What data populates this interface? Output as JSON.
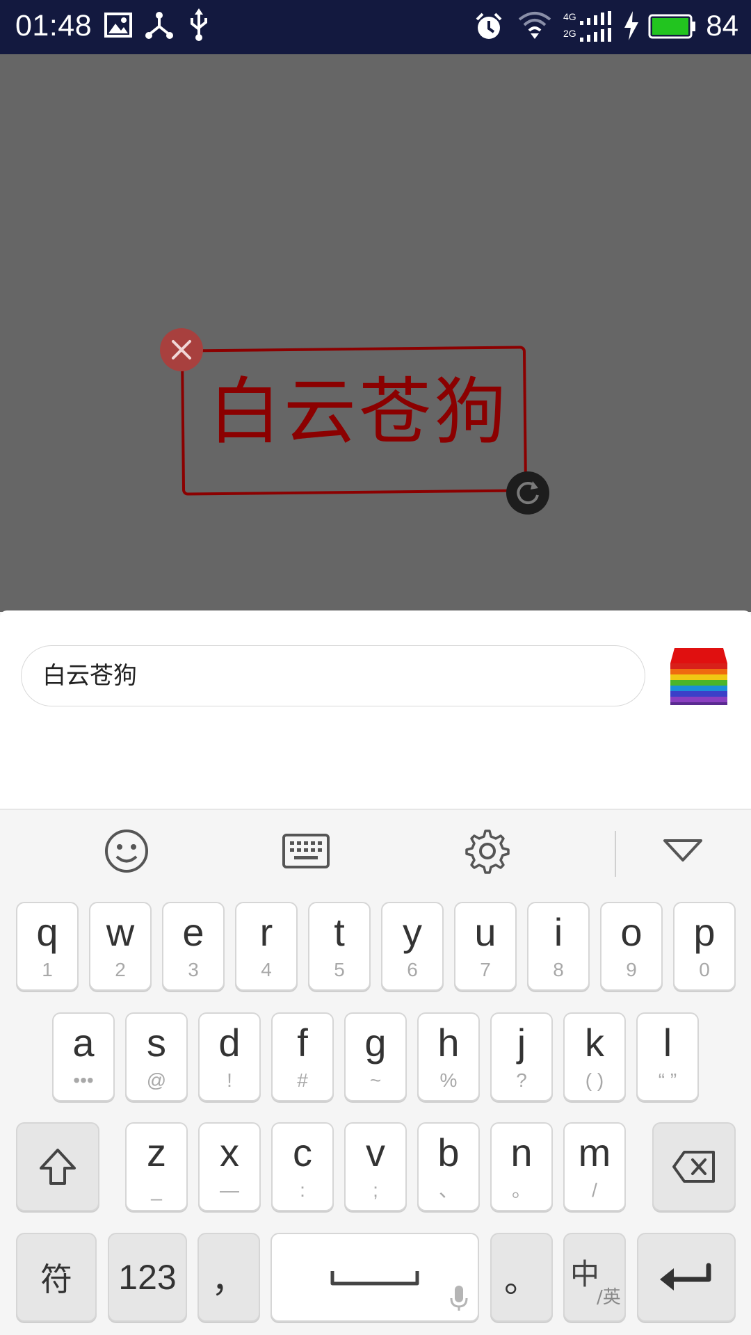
{
  "status_bar": {
    "time": "01:48",
    "network_4g": "4G",
    "network_2g": "2G",
    "battery_level": "84",
    "icons": [
      "image-icon",
      "share-network-icon",
      "usb-icon",
      "alarm-icon",
      "wifi-icon",
      "signal-icon",
      "charging-icon",
      "battery-icon"
    ]
  },
  "canvas": {
    "sticker_text": "白云苍狗",
    "sticker_color": "#8b0000",
    "background_color": "#666666"
  },
  "editor": {
    "text_value": "白云苍狗",
    "color_picker_icon": "rainbow-color-stack-icon"
  },
  "keyboard_toolbar": {
    "icons": [
      "emoji-icon",
      "keyboard-icon",
      "settings-gear-icon",
      "collapse-triangle-icon"
    ]
  },
  "keyboard": {
    "row1": [
      {
        "main": "q",
        "sub": "1"
      },
      {
        "main": "w",
        "sub": "2"
      },
      {
        "main": "e",
        "sub": "3"
      },
      {
        "main": "r",
        "sub": "4"
      },
      {
        "main": "t",
        "sub": "5"
      },
      {
        "main": "y",
        "sub": "6"
      },
      {
        "main": "u",
        "sub": "7"
      },
      {
        "main": "i",
        "sub": "8"
      },
      {
        "main": "o",
        "sub": "9"
      },
      {
        "main": "p",
        "sub": "0"
      }
    ],
    "row2": [
      {
        "main": "a",
        "sub": "•••"
      },
      {
        "main": "s",
        "sub": "@"
      },
      {
        "main": "d",
        "sub": "!"
      },
      {
        "main": "f",
        "sub": "#"
      },
      {
        "main": "g",
        "sub": "~"
      },
      {
        "main": "h",
        "sub": "%"
      },
      {
        "main": "j",
        "sub": "?"
      },
      {
        "main": "k",
        "sub": "( )"
      },
      {
        "main": "l",
        "sub": "“ ”"
      }
    ],
    "row3": [
      {
        "main": "z",
        "sub": "_"
      },
      {
        "main": "x",
        "sub": "—"
      },
      {
        "main": "c",
        "sub": ":"
      },
      {
        "main": "v",
        "sub": ";"
      },
      {
        "main": "b",
        "sub": "、"
      },
      {
        "main": "n",
        "sub": "。"
      },
      {
        "main": "m",
        "sub": "/"
      }
    ],
    "symbols_label": "符",
    "numbers_label": "123",
    "comma_label": "，",
    "period_label": "。",
    "lang_main": "中",
    "lang_sub": "/英"
  }
}
